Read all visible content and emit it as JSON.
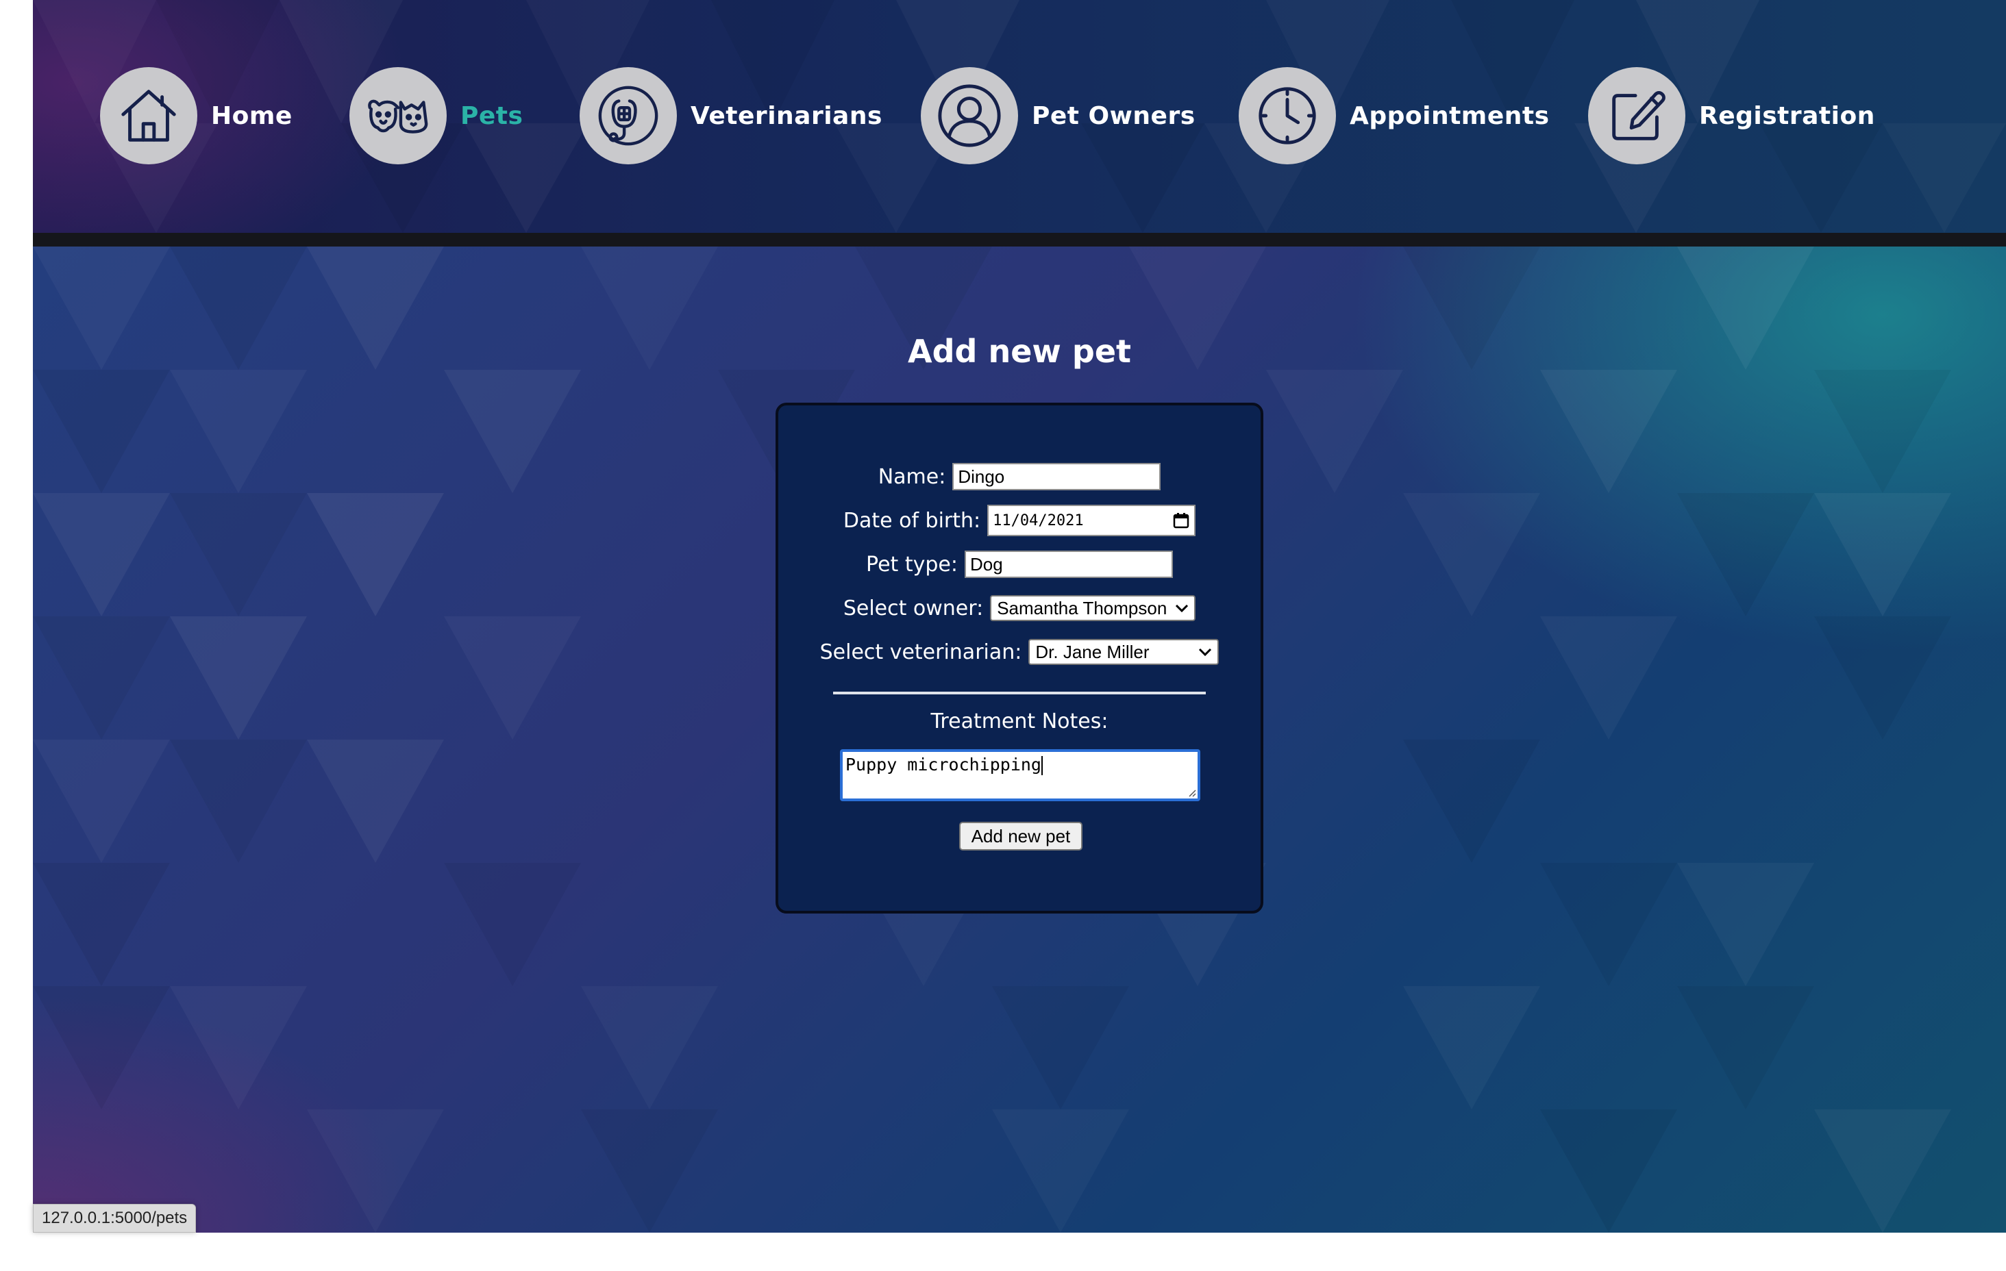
{
  "nav": {
    "items": [
      {
        "label": "Home",
        "icon": "home-icon"
      },
      {
        "label": "Pets",
        "icon": "pet-face-icon",
        "active": true
      },
      {
        "label": "Veterinarians",
        "icon": "stethoscope-icon"
      },
      {
        "label": "Pet Owners",
        "icon": "person-icon"
      },
      {
        "label": "Appointments",
        "icon": "clock-icon"
      },
      {
        "label": "Registration",
        "icon": "edit-icon"
      }
    ],
    "active_color": "#2bb3a7"
  },
  "page": {
    "title": "Add new pet"
  },
  "form": {
    "name_label": "Name:",
    "name_value": "Dingo",
    "dob_label": "Date of birth:",
    "dob_value": "11/04/2021",
    "pet_type_label": "Pet type:",
    "pet_type_value": "Dog",
    "owner_label": "Select owner:",
    "owner_value": "Samantha Thompson",
    "vet_label": "Select veterinarian:",
    "vet_value": "Dr. Jane Miller",
    "notes_label": "Treatment Notes:",
    "notes_value": "Puppy microchipping",
    "submit_label": "Add new pet"
  },
  "status_bar": {
    "url": "127.0.0.1:5000/pets"
  }
}
